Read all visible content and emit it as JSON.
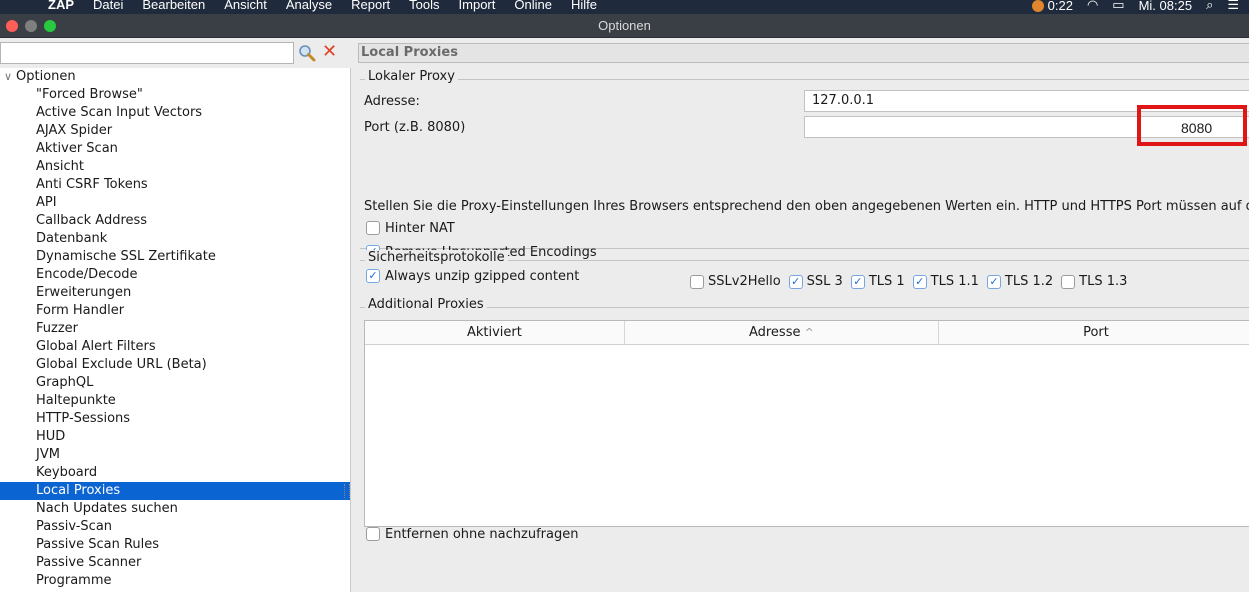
{
  "menubar": {
    "apple": "",
    "app": "ZAP",
    "items": [
      "Datei",
      "Bearbeiten",
      "Ansicht",
      "Analyse",
      "Report",
      "Tools",
      "Import",
      "Online",
      "Hilfe"
    ],
    "battery_time": "0:22",
    "clock": "Mi. 08:25"
  },
  "window": {
    "title": "Optionen"
  },
  "sidebar": {
    "search_value": "",
    "root": "Optionen",
    "items": [
      "\"Forced Browse\"",
      "Active Scan Input Vectors",
      "AJAX Spider",
      "Aktiver Scan",
      "Ansicht",
      "Anti CSRF Tokens",
      "API",
      "Callback Address",
      "Datenbank",
      "Dynamische SSL Zertifikate",
      "Encode/Decode",
      "Erweiterungen",
      "Form Handler",
      "Fuzzer",
      "Global Alert Filters",
      "Global Exclude URL (Beta)",
      "GraphQL",
      "Haltepunkte",
      "HTTP-Sessions",
      "HUD",
      "JVM",
      "Keyboard",
      "Local Proxies",
      "Nach Updates suchen",
      "Passiv-Scan",
      "Passive Scan Rules",
      "Passive Scanner",
      "Programme"
    ],
    "selected_index": 22
  },
  "panel": {
    "header": "Local Proxies",
    "proxy": {
      "title": "Lokaler Proxy",
      "address_label": "Adresse:",
      "address_value": "127.0.0.1",
      "port_label": "Port (z.B. 8080)",
      "port_value": "8080",
      "hint": "Stellen Sie die Proxy-Einstellungen Ihres Browsers entsprechend den oben angegebenen Werten ein. HTTP und HTTPS Port müssen auf den gl",
      "options": [
        {
          "label": "Hinter NAT",
          "checked": false
        },
        {
          "label": "Remove Unsupported Encodings",
          "checked": true
        },
        {
          "label": "Always unzip gzipped content",
          "checked": true
        }
      ]
    },
    "security": {
      "title": "Sicherheitsprotokolle",
      "protocols": [
        {
          "label": "SSLv2Hello",
          "checked": false
        },
        {
          "label": "SSL 3",
          "checked": true
        },
        {
          "label": "TLS 1",
          "checked": true
        },
        {
          "label": "TLS 1.1",
          "checked": true
        },
        {
          "label": "TLS 1.2",
          "checked": true
        },
        {
          "label": "TLS 1.3",
          "checked": false
        }
      ]
    },
    "additional": {
      "title": "Additional Proxies",
      "columns": [
        "Aktiviert",
        "Adresse",
        "Port"
      ],
      "sort_indicator": "^",
      "rows": []
    },
    "remove_without_prompt": {
      "label": "Entfernen ohne nachzufragen",
      "checked": false
    }
  },
  "colors": {
    "highlight": "#e01515",
    "selection": "#0a64d1",
    "close_light": "#fe5f57",
    "min_light": "#febc2e",
    "max_light": "#28c840"
  }
}
